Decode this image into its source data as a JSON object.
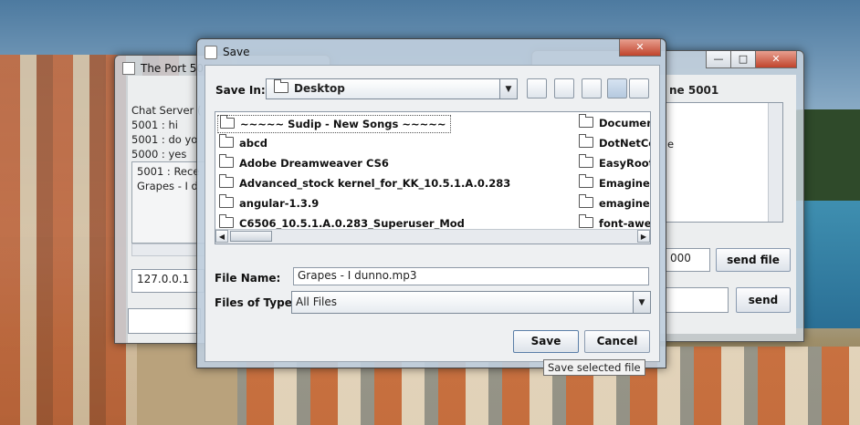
{
  "left_window": {
    "title": "The Port 50",
    "log": [
      "Chat Server (",
      "5001 :  hi",
      "5001 :  do yo",
      "5000 :  yes"
    ],
    "msgs": [
      "5001 : Rece",
      "Grapes - I d"
    ],
    "host_value": "127.0.0.1"
  },
  "right_window": {
    "title": "ne 5001",
    "side_text": "e",
    "port_value": "000",
    "send_file_label": "send file",
    "send_label": "send"
  },
  "dialog": {
    "title": "Save",
    "save_in_label": "Save In:",
    "save_in_value": "Desktop",
    "file_name_label": "File Name:",
    "file_name_value": "Grapes - I dunno.mp3",
    "files_of_type_label": "Files of Type:",
    "files_of_type_value": "All Files",
    "save_label": "Save",
    "cancel_label": "Cancel",
    "tooltip": "Save selected file",
    "files_col1": [
      "~~~~~ Sudip - New Songs ~~~~~",
      "abcd",
      "Adobe Dreamweaver CS6",
      "Advanced_stock kernel_for_KK_10.5.1.A.0.283",
      "angular-1.3.9",
      "C6506_10.5.1.A.0.283_Superuser_Mod"
    ],
    "files_col2": [
      "Document",
      "DotNetCon",
      "EasyRootT",
      "Emagine",
      "emagine u",
      "font-awes"
    ]
  }
}
